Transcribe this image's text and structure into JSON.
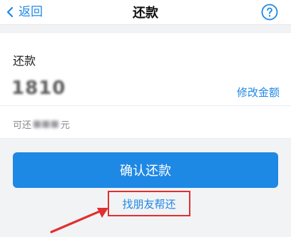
{
  "nav": {
    "back_label": "返回",
    "title": "还款",
    "help_icon": "help-circle-icon"
  },
  "repay": {
    "label": "还款",
    "amount": "1810",
    "edit_label": "修改金额",
    "available_prefix": "可还",
    "available_masked": "■■■",
    "available_suffix": "元"
  },
  "confirm": {
    "label": "确认还款"
  },
  "friend": {
    "label": "找朋友帮还"
  },
  "colors": {
    "accent": "#1e88e5",
    "highlight": "#e03030",
    "background": "#f2f3f5"
  }
}
